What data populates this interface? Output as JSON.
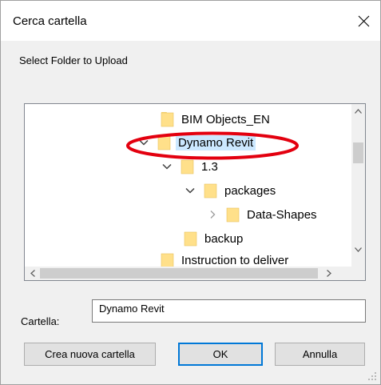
{
  "window": {
    "title": "Cerca cartella"
  },
  "prompt": "Select Folder to Upload",
  "tree": {
    "items": [
      {
        "label": "BIM Objects_EN",
        "expander": "none",
        "selected": false
      },
      {
        "label": "Dynamo Revit",
        "expander": "expanded",
        "selected": true
      },
      {
        "label": "1.3",
        "expander": "expanded",
        "selected": false
      },
      {
        "label": "packages",
        "expander": "expanded",
        "selected": false
      },
      {
        "label": "Data-Shapes",
        "expander": "collapsed",
        "selected": false
      },
      {
        "label": "backup",
        "expander": "none",
        "selected": false
      },
      {
        "label": "Instruction to deliver",
        "expander": "none",
        "selected": false
      }
    ]
  },
  "folder_field": {
    "label": "Cartella:",
    "value": "Dynamo Revit"
  },
  "buttons": {
    "new_folder": "Crea nuova cartella",
    "ok": "OK",
    "cancel": "Annulla"
  },
  "colors": {
    "selection": "#cce8ff",
    "folder": "#ffe08a",
    "annotation": "#e3000f",
    "focus_border": "#0078d7"
  },
  "icons": {
    "close": "close-icon",
    "folder": "folder-icon",
    "expanded": "chevron-down-icon",
    "collapsed": "chevron-right-icon"
  }
}
